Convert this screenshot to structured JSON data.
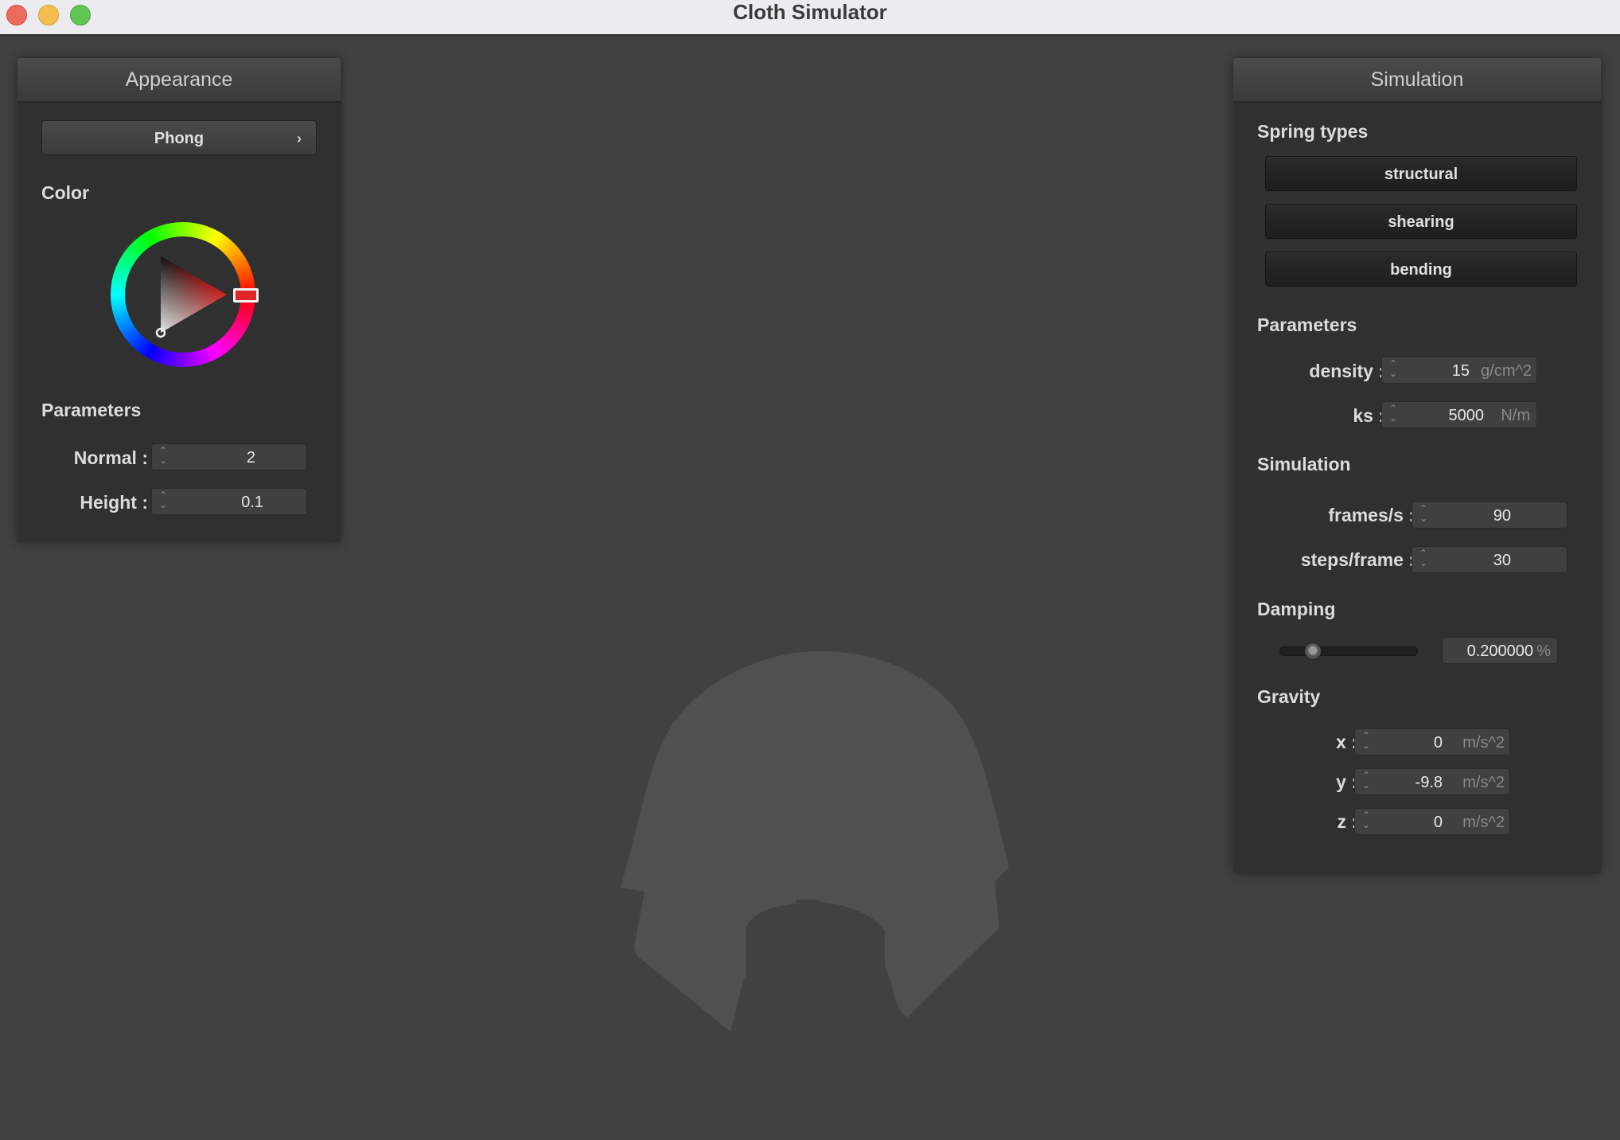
{
  "window": {
    "title": "Cloth Simulator"
  },
  "appearance": {
    "header": "Appearance",
    "shader": {
      "selected": "Phong",
      "chevron": "›"
    },
    "color_label": "Color",
    "color_value": "#e02828",
    "parameters_label": "Parameters",
    "normal": {
      "label": "Normal :",
      "value": "2"
    },
    "height": {
      "label": "Height :",
      "value": "0.1"
    }
  },
  "simulation": {
    "header": "Simulation",
    "spring_types_label": "Spring types",
    "spring_types": {
      "structural": "structural",
      "shearing": "shearing",
      "bending": "bending"
    },
    "parameters_label": "Parameters",
    "density": {
      "label": "density :",
      "value": "15",
      "unit": "g/cm^2"
    },
    "ks": {
      "label": "ks :",
      "value": "5000",
      "unit": "N/m"
    },
    "simulation_label": "Simulation",
    "frames": {
      "label": "frames/s :",
      "value": "90"
    },
    "steps": {
      "label": "steps/frame :",
      "value": "30"
    },
    "damping_label": "Damping",
    "damping": {
      "value": "0.200000",
      "unit": "%",
      "slider_fraction": 0.2
    },
    "gravity_label": "Gravity",
    "gx": {
      "label": "x :",
      "value": "0",
      "unit": "m/s^2"
    },
    "gy": {
      "label": "y :",
      "value": "-9.8",
      "unit": "m/s^2"
    },
    "gz": {
      "label": "z :",
      "value": "0",
      "unit": "m/s^2"
    }
  },
  "icons": {
    "spinner": "up-down-chevron-icon",
    "dropdown": "chevron-right-icon"
  },
  "colors": {
    "background": "#414141",
    "panel": "#303030",
    "cloth": "#505050"
  }
}
